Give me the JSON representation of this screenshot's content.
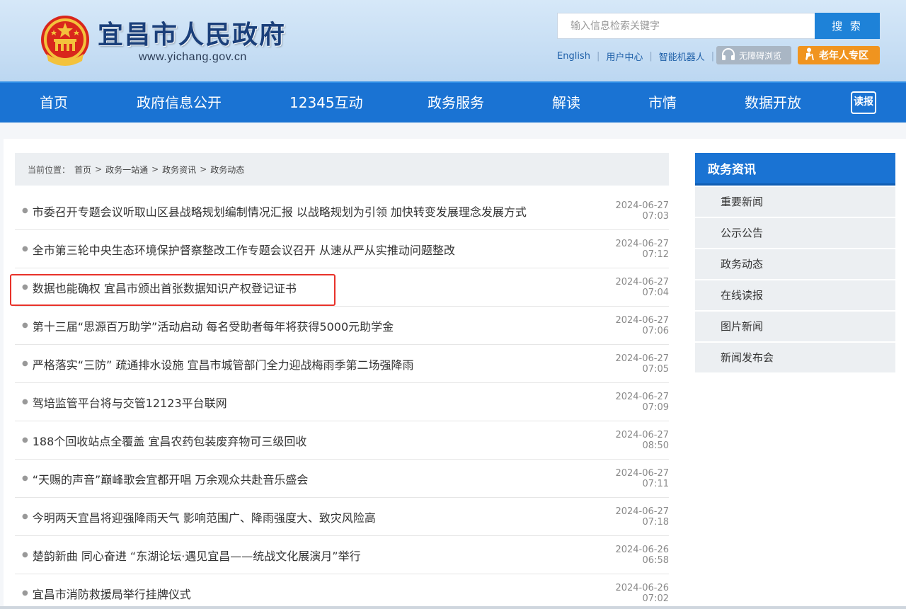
{
  "header": {
    "site_title": "宜昌市人民政府",
    "site_url": "www.yichang.gov.cn",
    "search_placeholder": "输入信息检索关键字",
    "search_button": "搜 索",
    "links": [
      "English",
      "用户中心",
      "智能机器人"
    ],
    "accessibility_label": "无障碍浏览",
    "elder_label": "老年人专区"
  },
  "nav": {
    "items": [
      "首页",
      "政府信息公开",
      "12345互动",
      "政务服务",
      "解读",
      "市情",
      "数据开放"
    ],
    "report_icon_label": "读报"
  },
  "breadcrumb": {
    "prefix": "当前位置：",
    "items": [
      "首页",
      "政务一站通",
      "政务资讯",
      "政务动态"
    ],
    "separator": ">"
  },
  "news": [
    {
      "title": "市委召开专题会议听取山区县战略规划编制情况汇报 以战略规划为引领 加快转变发展理念发展方式",
      "date": "2024-06-27 07:03"
    },
    {
      "title": "全市第三轮中央生态环境保护督察整改工作专题会议召开 从速从严从实推动问题整改",
      "date": "2024-06-27 07:12"
    },
    {
      "title": "数据也能确权 宜昌市颁出首张数据知识产权登记证书",
      "date": "2024-06-27 07:04"
    },
    {
      "title": "第十三届“思源百万助学”活动启动 每名受助者每年将获得5000元助学金",
      "date": "2024-06-27 07:06"
    },
    {
      "title": "严格落实“三防” 疏通排水设施 宜昌市城管部门全力迎战梅雨季第二场强降雨",
      "date": "2024-06-27 07:05"
    },
    {
      "title": "驾培监管平台将与交管12123平台联网",
      "date": "2024-06-27 07:09"
    },
    {
      "title": "188个回收站点全覆盖 宜昌农药包装废弃物可三级回收",
      "date": "2024-06-27 08:50"
    },
    {
      "title": "“天赐的声音”巅峰歌会宜都开唱 万余观众共赴音乐盛会",
      "date": "2024-06-27 07:11"
    },
    {
      "title": "今明两天宜昌将迎强降雨天气 影响范围广、降雨强度大、致灾风险高",
      "date": "2024-06-27 07:18"
    },
    {
      "title": "楚韵新曲 同心奋进 “东湖论坛·遇见宜昌——统战文化展演月”举行",
      "date": "2024-06-26 06:58"
    },
    {
      "title": "宜昌市消防救援局举行挂牌仪式",
      "date": "2024-06-26 07:02"
    }
  ],
  "sidebar": {
    "title": "政务资讯",
    "items": [
      "重要新闻",
      "公示公告",
      "政务动态",
      "在线读报",
      "图片新闻",
      "新闻发布会"
    ]
  },
  "colors": {
    "nav_blue": "#1a73d3",
    "header_bg": "#c7def4",
    "elder_orange": "#f0941f",
    "highlight_red": "#e8322a"
  }
}
